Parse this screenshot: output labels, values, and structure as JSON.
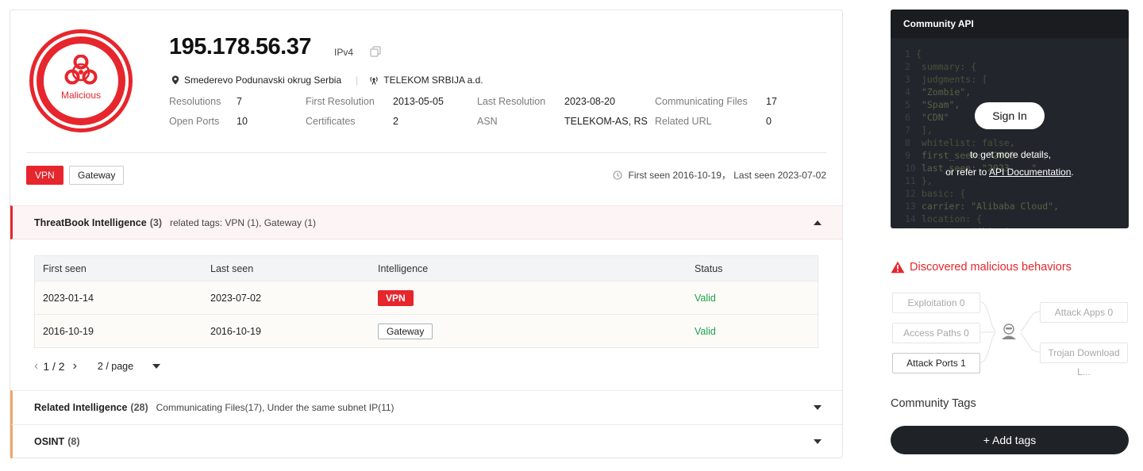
{
  "summary": {
    "verdict": "Malicious",
    "ip": "195.178.56.37",
    "ip_type": "IPv4",
    "location": "Smederevo Podunavski okrug Serbia",
    "isp": "TELEKOM SRBIJA a.d.",
    "stats": [
      {
        "label": "Resolutions",
        "value": "7"
      },
      {
        "label": "First Resolution",
        "value": "2013-05-05"
      },
      {
        "label": "Last Resolution",
        "value": "2023-08-20"
      },
      {
        "label": "Communicating Files",
        "value": "17"
      },
      {
        "label": "Open Ports",
        "value": "10"
      },
      {
        "label": "Certificates",
        "value": "2"
      },
      {
        "label": "ASN",
        "value": "TELEKOM-AS, RS"
      },
      {
        "label": "Related URL",
        "value": "0"
      }
    ],
    "tags": [
      "VPN",
      "Gateway"
    ],
    "seen_text": "First seen 2016-10-19，  Last seen 2023-07-02"
  },
  "threatbook": {
    "title": "ThreatBook Intelligence",
    "count": "(3)",
    "related": "related tags: VPN (1), Gateway (1)",
    "columns": [
      "First seen",
      "Last seen",
      "Intelligence",
      "Status"
    ],
    "rows": [
      {
        "first": "2023-01-14",
        "last": "2023-07-02",
        "intel": "VPN",
        "status": "Valid"
      },
      {
        "first": "2016-10-19",
        "last": "2016-10-19",
        "intel": "Gateway",
        "status": "Valid"
      }
    ],
    "pagination": {
      "page": "1 / 2",
      "page_size": "2 / page"
    }
  },
  "related_intel": {
    "title": "Related Intelligence",
    "count": "(28)",
    "sub": "Communicating Files(17), Under the same subnet IP(11)"
  },
  "osint": {
    "title": "OSINT",
    "count": "(8)"
  },
  "api": {
    "title": "Community API",
    "sign_in": "Sign In",
    "msg1": "to get more details,",
    "msg2_prefix": "or refer to ",
    "msg2_link": "API Documentation",
    "msg2_suffix": ".",
    "code_lines": [
      "{",
      "  summary: {",
      "    judgments: [",
      "      \"Zombie\",",
      "      \"Spam\",",
      "      \"CDN\"",
      "    ],",
      "    whitelist: false,",
      "    first_seen: \"2013-...\",",
      "    last_seen: \"2023-...\",",
      "  },",
      "  basic: {",
      "    carrier: \"Alibaba Cloud\",",
      "    location: {",
      "      country: \"China\","
    ]
  },
  "malicious": {
    "title": "Discovered malicious behaviors",
    "nodes": {
      "exploitation": "Exploitation 0",
      "access_paths": "Access Paths 0",
      "attack_ports": "Attack Ports 1",
      "attack_apps": "Attack Apps 0",
      "trojan_download": "Trojan Download L..."
    }
  },
  "community_tags": {
    "title": "Community Tags",
    "add_button": "+ Add tags"
  },
  "colors": {
    "danger": "#e6262c",
    "valid": "#1aa14e",
    "accent_orange": "#f0a66b",
    "dark": "#1f2227"
  }
}
